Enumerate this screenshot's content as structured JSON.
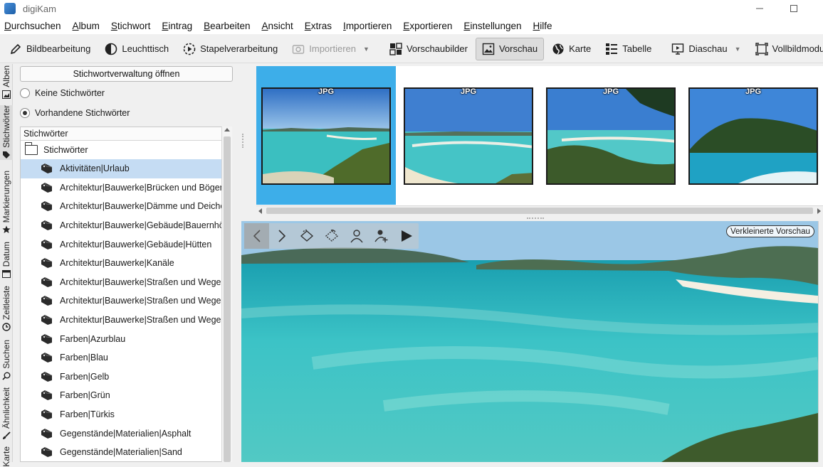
{
  "window": {
    "title": "digiKam"
  },
  "menu": [
    "Durchsuchen",
    "Album",
    "Stichwort",
    "Eintrag",
    "Bearbeiten",
    "Ansicht",
    "Extras",
    "Importieren",
    "Exportieren",
    "Einstellungen",
    "Hilfe"
  ],
  "toolbar": {
    "image_editor": "Bildbearbeitung",
    "light_table": "Leuchttisch",
    "batch_queue": "Stapelverarbeitung",
    "import": "Importieren",
    "thumbnails": "Vorschaubilder",
    "preview": "Vorschau",
    "map": "Karte",
    "table": "Tabelle",
    "slideshow": "Diaschau",
    "fullscreen": "Vollbildmodus"
  },
  "sidetabs": [
    "Alben",
    "Stichwörter",
    "Markierungen",
    "Datum",
    "Zeitleiste",
    "Suchen",
    "Ähnlichkeit",
    "Karte"
  ],
  "keywords_panel": {
    "manage_button": "Stichwortverwaltung öffnen",
    "radio_none": "Keine Stichwörter",
    "radio_existing": "Vorhandene Stichwörter",
    "tree_header": "Stichwörter",
    "tree_root": "Stichwörter",
    "items": [
      "Aktivitäten|Urlaub",
      "Architektur|Bauwerke|Brücken und Bögen|",
      "Architektur|Bauwerke|Dämme und Deiche|",
      "Architektur|Bauwerke|Gebäude|Bauernhöf",
      "Architektur|Bauwerke|Gebäude|Hütten",
      "Architektur|Bauwerke|Kanäle",
      "Architektur|Bauwerke|Straßen und Wege|S",
      "Architektur|Bauwerke|Straßen und Wege|S",
      "Architektur|Bauwerke|Straßen und Wege|V",
      "Farben|Azurblau",
      "Farben|Blau",
      "Farben|Gelb",
      "Farben|Grün",
      "Farben|Türkis",
      "Gegenstände|Materialien|Asphalt",
      "Gegenstände|Materialien|Sand"
    ]
  },
  "thumbnails": [
    {
      "format": "JPG"
    },
    {
      "format": "JPG"
    },
    {
      "format": "JPG"
    },
    {
      "format": "JPG"
    }
  ],
  "preview": {
    "badge": "Verkleinerte Vorschau"
  },
  "colors": {
    "selection": "#3daee9",
    "tree_selected": "#c5dcf3"
  }
}
